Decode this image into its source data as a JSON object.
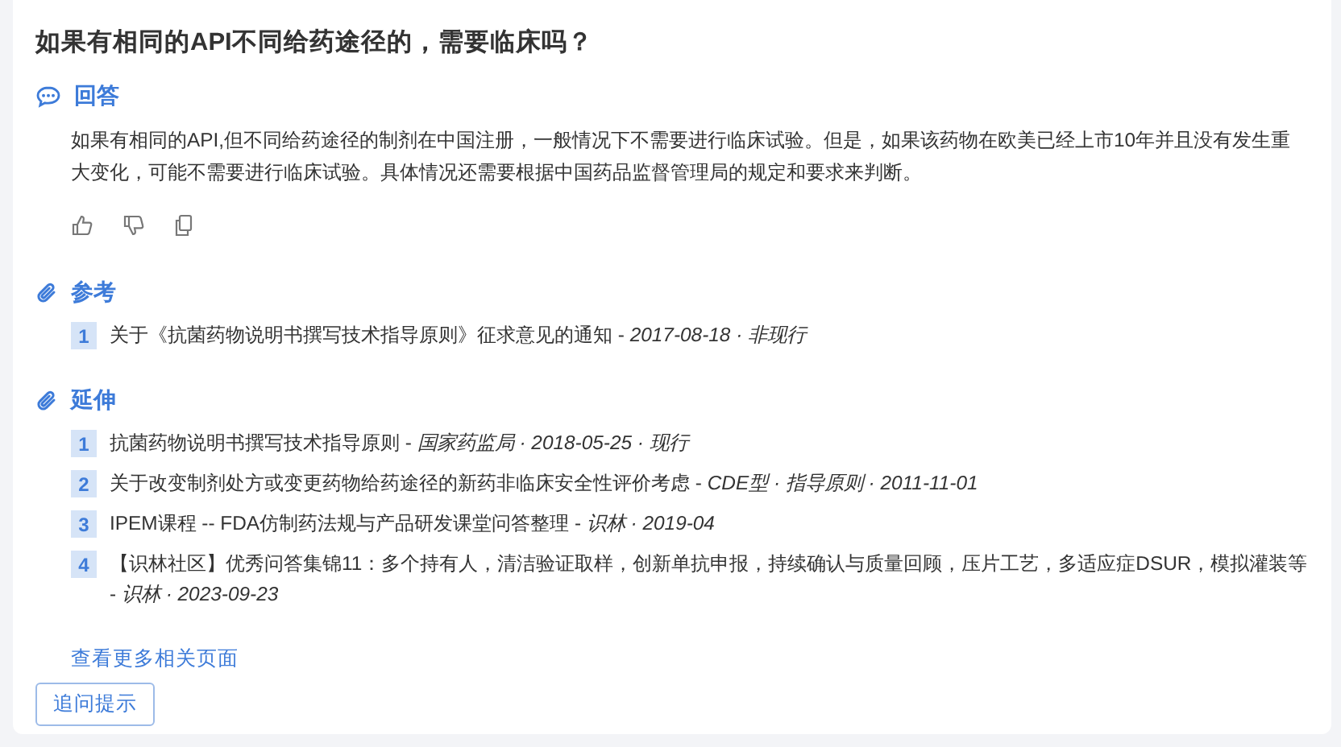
{
  "question": "如果有相同的API不同给药途径的，需要临床吗？",
  "answer": {
    "heading": "回答",
    "text": "如果有相同的API,但不同给药途径的制剂在中国注册，一般情况下不需要进行临床试验。但是，如果该药物在欧美已经上市10年并且没有发生重大变化，可能不需要进行临床试验。具体情况还需要根据中国药品监督管理局的规定和要求来判断。"
  },
  "references": {
    "heading": "参考",
    "items": [
      {
        "number": "1",
        "text": "关于《抗菌药物说明书撰写技术指导原则》征求意见的通知 - *2017-08-18 · 非现行*"
      }
    ]
  },
  "extended": {
    "heading": "延伸",
    "items": [
      {
        "number": "1",
        "text": "抗菌药物说明书撰写技术指导原则 - *国家药监局 · 2018-05-25 · 现行*"
      },
      {
        "number": "2",
        "text": "关于改变制剂处方或变更药物给药途径的新药非临床安全性评价考虑 - *CDE型 · 指导原则 · 2011-11-01*"
      },
      {
        "number": "3",
        "text": "IPEM课程 -- FDA仿制药法规与产品研发课堂问答整理 - *识林 · 2019-04*"
      },
      {
        "number": "4",
        "text": "【识林社区】优秀问答集锦11：多个持有人，清洁验证取样，创新单抗申报，持续确认与质量回顾，压片工艺，多适应症DSUR，模拟灌装等 - *识林 · 2023-09-23*"
      }
    ],
    "more_link": "查看更多相关页面"
  },
  "follow_up_button": "追问提示"
}
